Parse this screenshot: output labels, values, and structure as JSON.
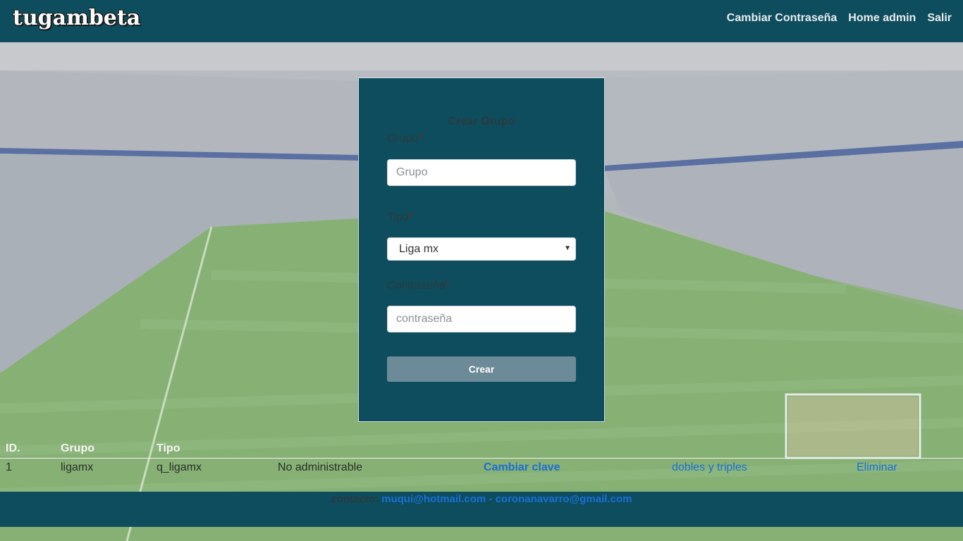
{
  "header": {
    "logo_text": "tugambeta",
    "nav": [
      "Cambiar Contraseña",
      "Home admin",
      "Salir"
    ]
  },
  "form": {
    "title": "Crear Grupo",
    "grupo_label": "Grupo",
    "grupo_placeholder": "Grupo",
    "tipo_label": "Tipo",
    "tipo_selected": "Liga mx",
    "pass_label": "Contraseña",
    "pass_placeholder": "contraseña",
    "required_mark": "*",
    "submit_label": "Crear"
  },
  "table": {
    "headers": [
      "ID.",
      "Grupo",
      "Tipo"
    ],
    "rows": [
      {
        "id": "1",
        "grupo": "ligamx",
        "tipo": "q_ligamx",
        "estado": "No administrable",
        "cambiar": "Cambiar clave",
        "dobles": "dobles y triples",
        "eliminar": "Eliminar"
      }
    ]
  },
  "footer": {
    "contact_label": "contacto:",
    "email1": "muqui@hotmail.com",
    "separator": "-",
    "email2": "coronanavarro@gmail.com"
  },
  "colors": {
    "header_bg": "#0e4d5d",
    "button_bg": "#6c8a97",
    "link": "#1a6fd6"
  }
}
